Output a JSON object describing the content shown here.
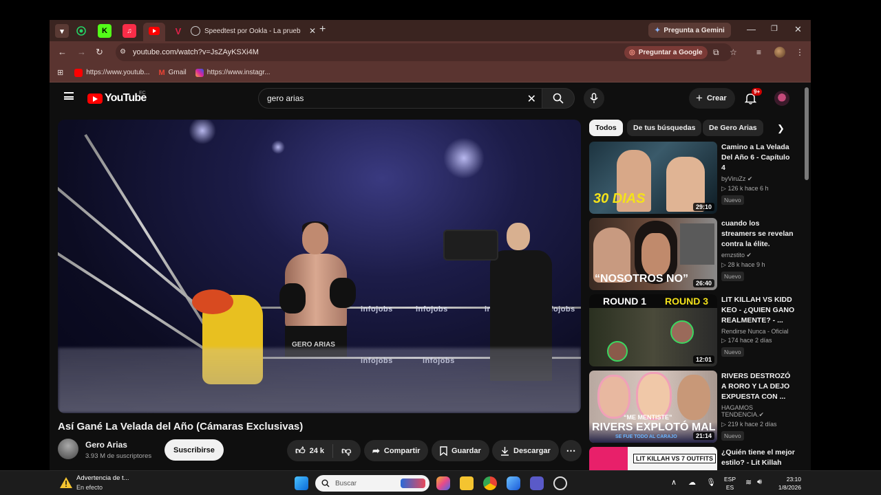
{
  "browser": {
    "tab_title": "Speedtest por Ookla - La prueb",
    "gemini_label": "Pregunta a Gemini",
    "url": "youtube.com/watch?v=JsZAyKSXi4M",
    "ask_google_label": "Preguntar a Google",
    "bookmarks": [
      {
        "label": "https://www.youtub...",
        "icon": "youtube-icon",
        "color": "#ff0000"
      },
      {
        "label": "Gmail",
        "icon": "gmail-icon",
        "color": "#ea4335"
      },
      {
        "label": "https://www.instagr...",
        "icon": "instagram-icon",
        "color": "#d6249f"
      }
    ]
  },
  "youtube": {
    "logo_text": "YouTube",
    "country_code": "EC",
    "search_value": "gero arias",
    "create_label": "Crear",
    "notif_count": "9+",
    "video": {
      "title": "Así Gané La Velada del Año (Cámaras Exclusivas)",
      "banner_text": "infojobs",
      "trunks_text": "GERO ARIAS",
      "channel": "Gero Arias",
      "subscribers": "3.93 M de suscriptores",
      "subscribe_label": "Suscribirse",
      "likes": "24 k",
      "share_label": "Compartir",
      "save_label": "Guardar",
      "download_label": "Descargar"
    },
    "chips": [
      "Todos",
      "De tus búsquedas",
      "De Gero Arias"
    ],
    "recommendations": [
      {
        "title": "Camino a La Velada Del Año 6 - Capítulo 4",
        "channel": "byViruZz",
        "verified": true,
        "views": "126 k",
        "age": "hace 6 h",
        "badge": "Nuevo",
        "duration": "29:10",
        "thumb_text": "30 DIAS"
      },
      {
        "title": "cuando los streamers se revelan contra la élite.",
        "channel": "ernzstito",
        "verified": true,
        "views": "28 k",
        "age": "hace 9 h",
        "badge": "Nuevo",
        "duration": "26:40",
        "thumb_text": "“NOSOTROS NO”"
      },
      {
        "title": "LIT KILLAH VS KIDD KEO - ¿QUIEN GANO REALMENTE? - ...",
        "channel": "Rendirse Nunca - Oficial",
        "verified": false,
        "views": "174",
        "age": "hace 2 días",
        "badge": "Nuevo",
        "duration": "12:01",
        "thumb_text": "ROUND 1",
        "thumb_text2": "ROUND 3"
      },
      {
        "title": "RIVERS DESTROZÓ A RORO Y LA DEJO EXPUESTA CON ...",
        "channel": "HAGAMOS TENDENCIA.",
        "verified": true,
        "views": "219 k",
        "age": "hace 2 días",
        "badge": "Nuevo",
        "duration": "21:14",
        "thumb_text": "RIVERS EXPLOTÓ MAL",
        "thumb_sub": "SE FUE TODO AL CARAJO",
        "thumb_quote": "“ME MENTISTE”"
      },
      {
        "title": "¿Quién tiene el mejor estilo? - Lit Killah",
        "thumb_text": "LIT KILLAH VS 7 OUTFITS"
      }
    ]
  },
  "taskbar": {
    "warning_title": "Advertencia de t...",
    "warning_sub": "En efecto",
    "search_placeholder": "Buscar",
    "lang1": "ESP",
    "lang2": "ES",
    "time": "23:10",
    "date": "1/8/2026"
  }
}
